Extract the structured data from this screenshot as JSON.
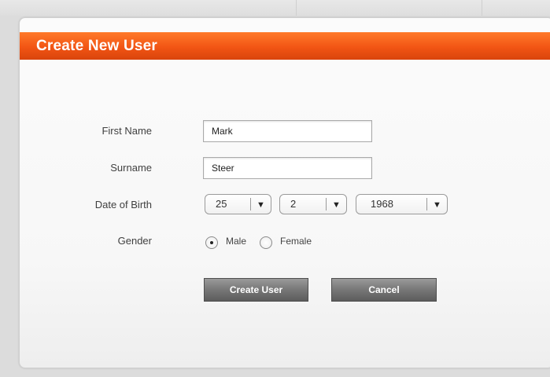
{
  "form": {
    "title": "Create New User",
    "labels": {
      "first_name": "First Name",
      "surname": "Surname",
      "date_of_birth": "Date of Birth",
      "gender": "Gender"
    },
    "first_name_value": "Mark",
    "surname_value": "Steer",
    "dob": {
      "day": "25",
      "month": "2",
      "year": "1968"
    },
    "gender": {
      "options": [
        "Male",
        "Female"
      ],
      "selected": "Male"
    },
    "buttons": {
      "create": "Create User",
      "cancel": "Cancel"
    }
  },
  "colors": {
    "header_orange": "#f25514",
    "button_gray": "#7a7a7a",
    "panel_bg": "#f8f8f8"
  }
}
